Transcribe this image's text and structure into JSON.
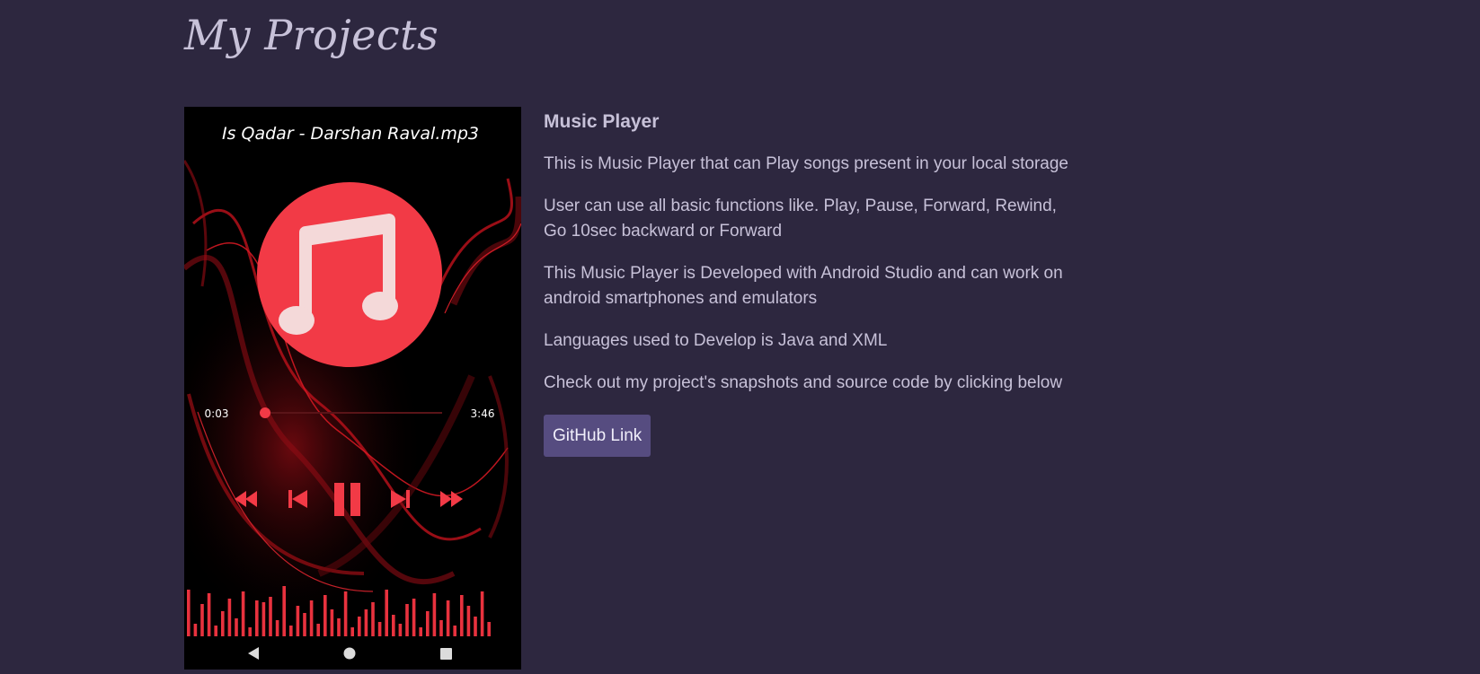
{
  "page": {
    "title": "My Projects"
  },
  "project": {
    "title": "Music Player",
    "paragraphs": [
      "This is Music Player that can Play songs present in your local storage",
      "User can use all basic functions like. Play, Pause, Forward, Rewind, Go 10sec backward or Forward",
      "This Music Player is Developed with Android Studio and can work on android smartphones and emulators",
      "Languages used to Develop is Java and XML",
      "Check out my project's snapshots and source code by clicking below"
    ],
    "button_label": "GitHub Link",
    "snapshot": {
      "song_title": "Is Qadar - Darshan Raval.mp3",
      "elapsed": "0:03",
      "duration": "3:46",
      "progress": 0.02,
      "album_icon": "music-note-icon",
      "controls": [
        "fast-rewind-icon",
        "skip-previous-icon",
        "pause-icon",
        "skip-next-icon",
        "fast-forward-icon"
      ],
      "nav_icons": [
        "back-icon",
        "home-icon",
        "recents-icon"
      ],
      "colors": {
        "accent": "#f23a46",
        "visualizer": "#e8323e",
        "background": "#000000"
      }
    }
  },
  "colors": {
    "page_background": "#2d273f",
    "text": "#c7c1d8",
    "button_background": "#564c80"
  }
}
